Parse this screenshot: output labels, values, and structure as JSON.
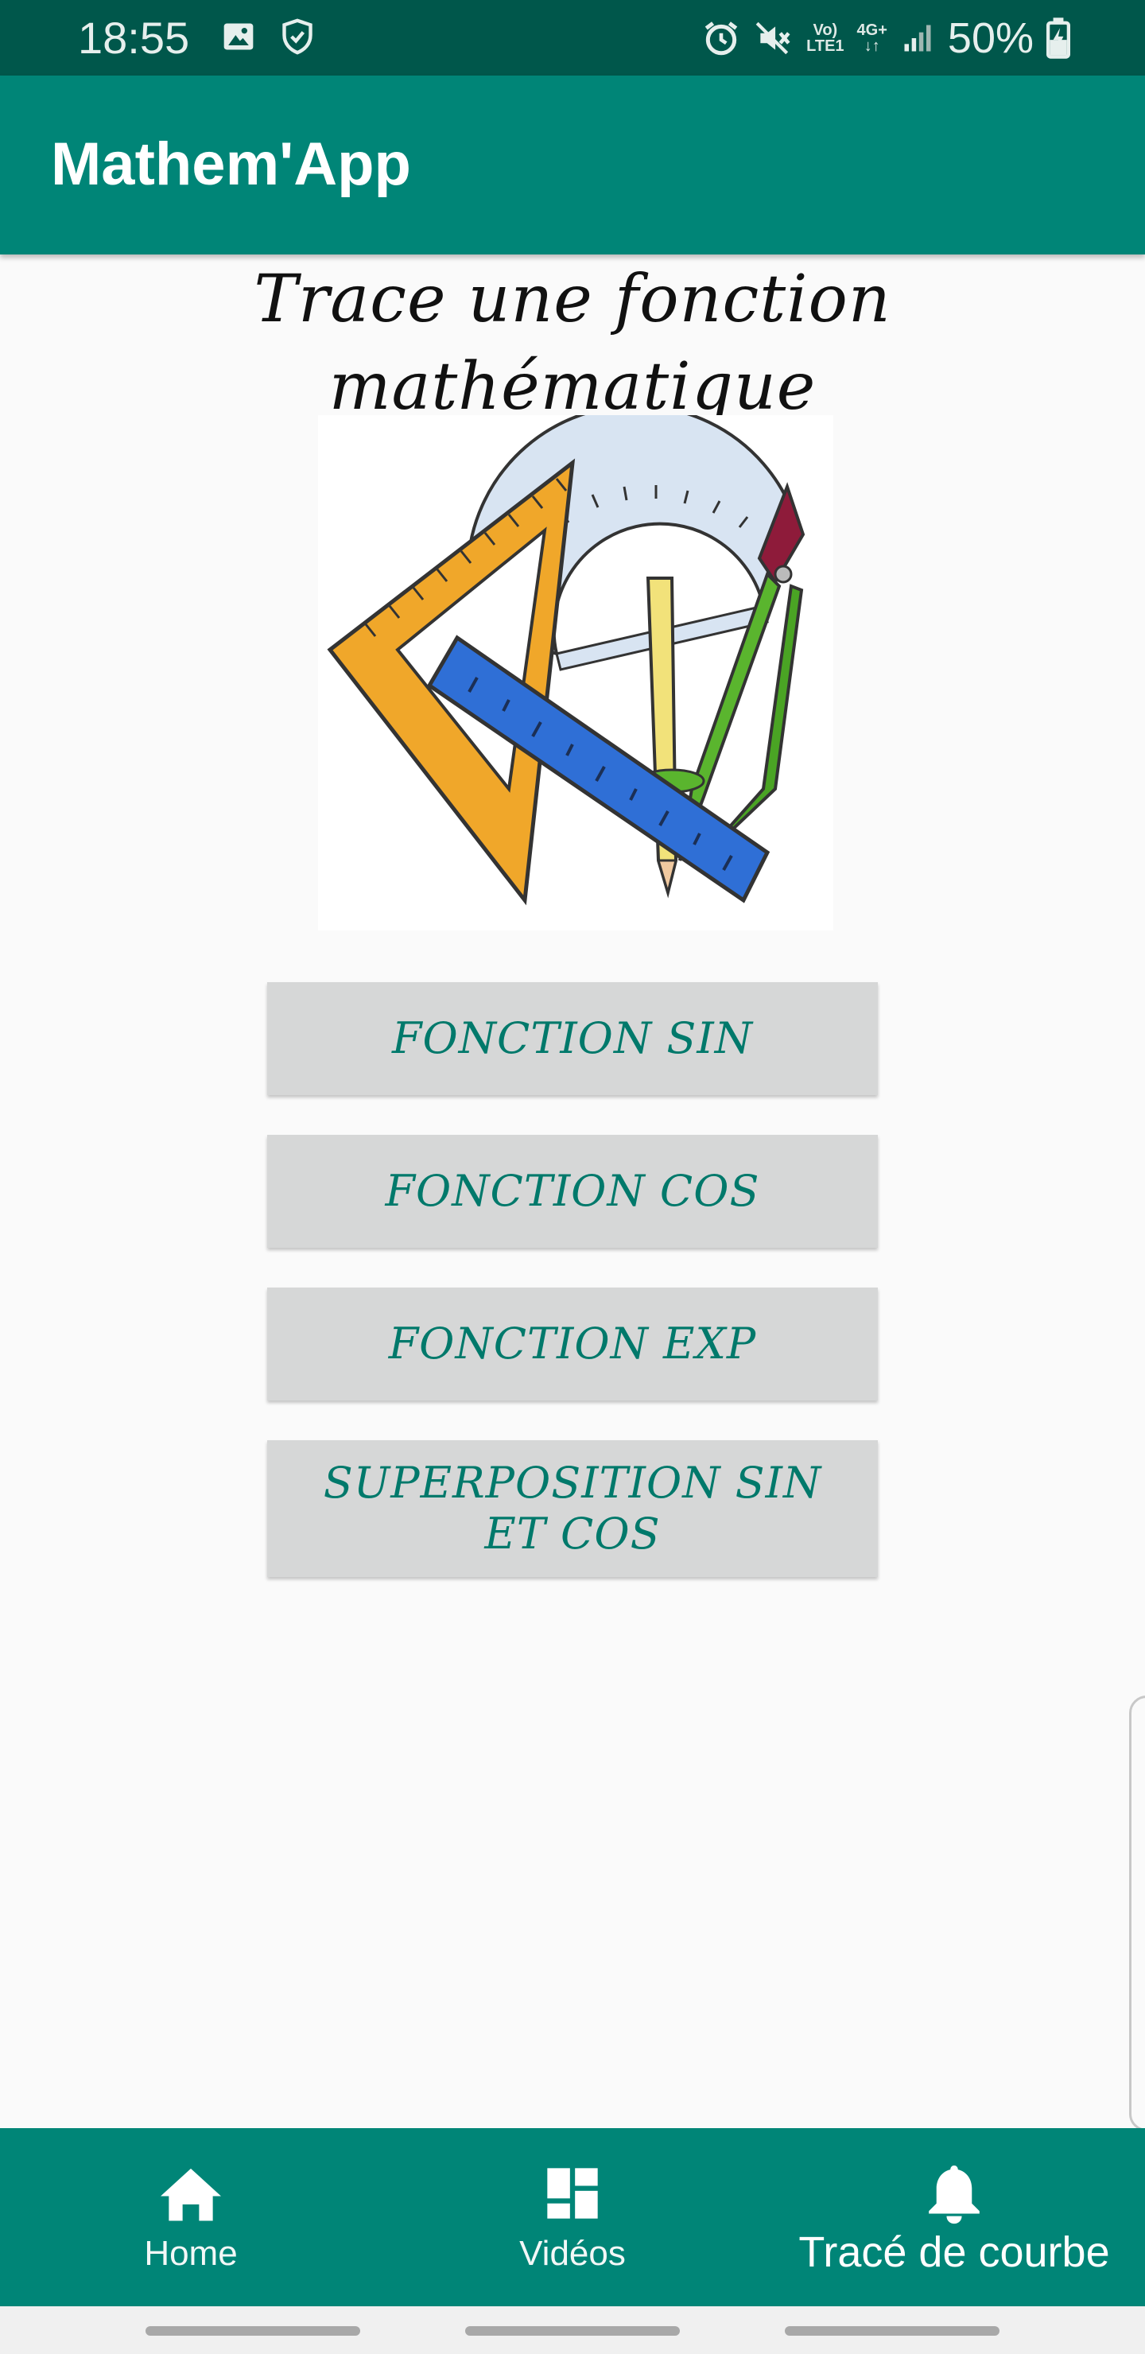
{
  "status_bar": {
    "time": "18:55",
    "left_icons": [
      "image-icon",
      "shield-check-icon"
    ],
    "right_icons": [
      "alarm-icon",
      "mute-icon",
      "volte-icon",
      "4g-icon",
      "signal-icon",
      "battery-charging-icon"
    ],
    "volte_line1": "Vo)",
    "volte_line2": "LTE1",
    "network_type": "4G+",
    "battery": "50%"
  },
  "app_bar": {
    "title": "Mathem'App",
    "color": "#008577"
  },
  "page": {
    "heading": "Trace une fonction mathématique",
    "image": "geometry-tools-illustration"
  },
  "buttons": [
    {
      "label": "FONCTION SIN"
    },
    {
      "label": "FONCTION COS"
    },
    {
      "label": "FONCTION EXP"
    },
    {
      "label": "SUPERPOSITION SIN ET COS"
    }
  ],
  "bottom_nav": {
    "items": [
      {
        "label": "Home",
        "icon": "home-icon"
      },
      {
        "label": "Vidéos",
        "icon": "dashboard-icon"
      },
      {
        "label": "Tracé de courbe",
        "icon": "bell-icon",
        "active": true
      }
    ]
  },
  "colors": {
    "primary": "#008577",
    "primary_dark": "#00574b",
    "accent_text": "#00796b",
    "button_bg": "#d6d7d7"
  }
}
